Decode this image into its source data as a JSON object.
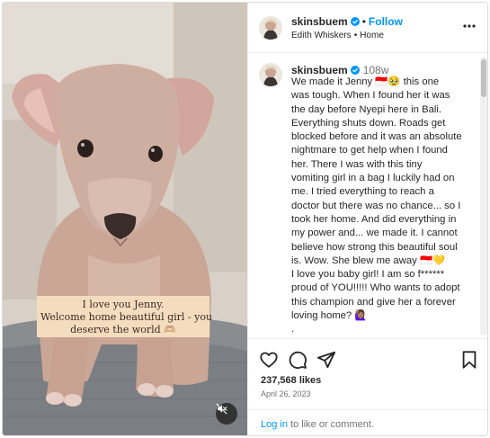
{
  "post": {
    "username": "skinsbuem",
    "follow_label": "Follow",
    "separator": "•",
    "subtitle_user": "Edith Whiskers",
    "subtitle_place": "Home"
  },
  "media": {
    "overlay_lines": [
      "I love you Jenny.",
      "Welcome home beautiful girl - you",
      "deserve the world 🫶🏼"
    ],
    "muted": true,
    "icon": "speaker-muted-icon"
  },
  "comment": {
    "username": "skinsbuem",
    "age": "108w",
    "lines": [
      "We made it Jenny 🇮🇩🥹 this one",
      "was tough. When I found her it was",
      "the day before Nyepi here in Bali.",
      "Everything shuts down. Roads get",
      "blocked before and it was an absolute",
      "nightmare to get help when I found",
      "her. There I was with this tiny",
      "vomiting girl in a bag I luckily had on",
      "me. I tried everything to reach a",
      "doctor but there was no chance... so I",
      "took her home. And did everything in",
      "my power and... we made it. I cannot",
      "believe how strong this beautiful soul",
      "is. Wow. She blew me away 🇮🇩💛",
      "I love you baby girl! I am so f******",
      "proud of YOU!!!!! Who wants to adopt",
      "this champion and give her a forever",
      "loving home? 🙋🏽‍♀️",
      ".",
      "."
    ]
  },
  "actions": {
    "likes": "237,568 likes",
    "date": "April 26, 2023",
    "login_link": "Log in",
    "login_rest": " to like or comment."
  },
  "colors": {
    "accent": "#0095f6",
    "text": "#262626",
    "muted": "#737373",
    "verified": "#0095f6",
    "overlay_bg": "#f4dcbf"
  }
}
